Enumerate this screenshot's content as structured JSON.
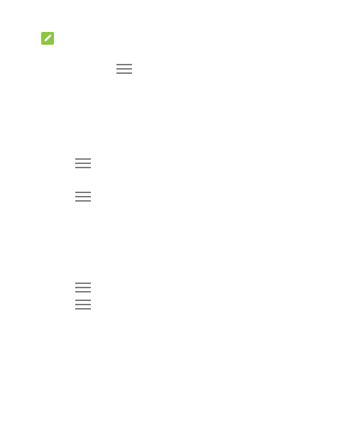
{
  "colors": {
    "note_badge": "#8cc63f",
    "menu_glyph": "#7a7a7a",
    "background": "#ffffff"
  },
  "icons": {
    "note": "pencil-edit-icon",
    "menu": "menu-icon"
  }
}
